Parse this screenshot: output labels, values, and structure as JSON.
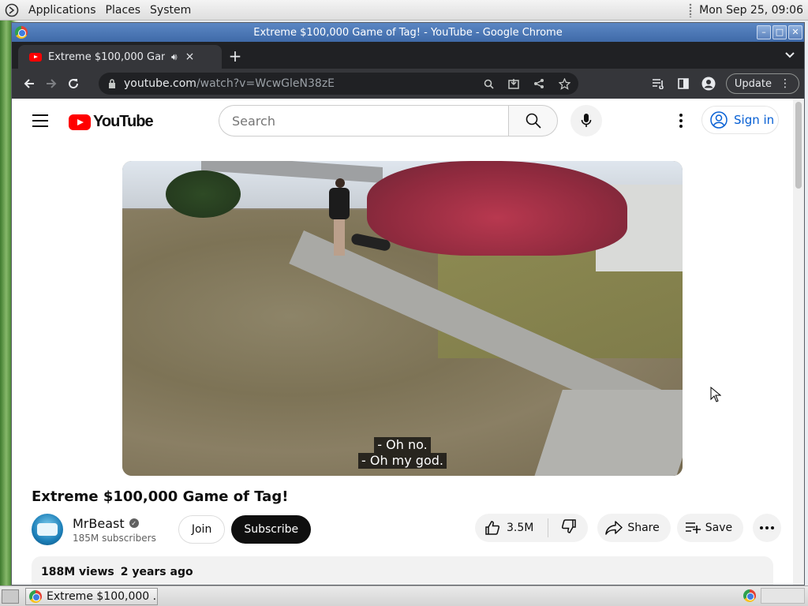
{
  "top_panel": {
    "menus": [
      "Applications",
      "Places",
      "System"
    ],
    "clock": "Mon Sep 25, 09:06"
  },
  "window": {
    "title": "Extreme $100,000 Game of Tag! - YouTube - Google Chrome",
    "buttons": [
      "minimize",
      "maximize",
      "close"
    ]
  },
  "tab": {
    "title": "Extreme $100,000 Game of Tag!",
    "close": "×"
  },
  "toolbar": {
    "url_host": "youtube.com",
    "url_path": "/watch?v=WcwGleN38zE",
    "update_label": "Update"
  },
  "youtube": {
    "logo_text": "YouTube",
    "search_placeholder": "Search",
    "sign_in": "Sign in"
  },
  "video": {
    "captions": [
      "- Oh no.",
      "- Oh my god."
    ],
    "title": "Extreme $100,000 Game of Tag!",
    "channel": "MrBeast",
    "subscribers": "185M subscribers",
    "join": "Join",
    "subscribe": "Subscribe",
    "likes": "3.5M",
    "share": "Share",
    "save": "Save",
    "views": "188M views",
    "age": "2 years ago"
  },
  "taskbar": {
    "task_label": "Extreme $100,000 ..."
  }
}
